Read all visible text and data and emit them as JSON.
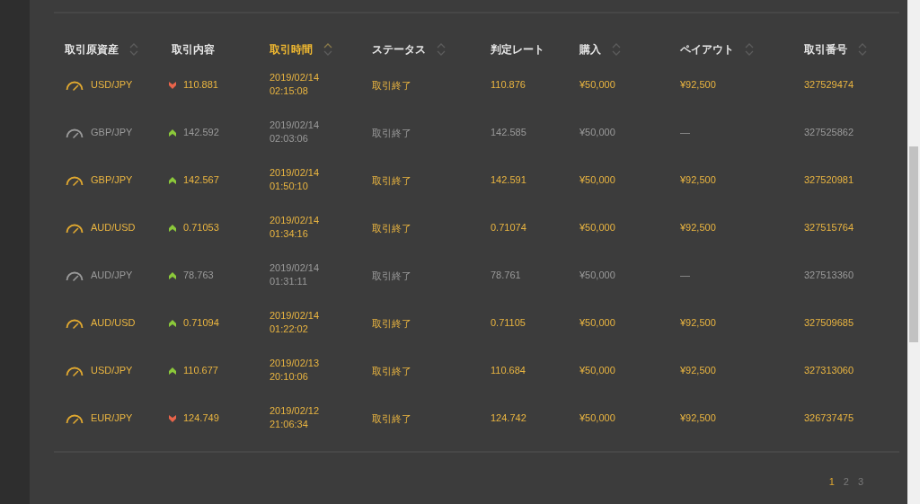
{
  "table": {
    "columns": [
      {
        "label": "取引原資産",
        "sortable": true,
        "active": false
      },
      {
        "label": "取引内容",
        "sortable": false,
        "active": false
      },
      {
        "label": "取引時間",
        "sortable": true,
        "active": true
      },
      {
        "label": "ステータス",
        "sortable": true,
        "active": false
      },
      {
        "label": "判定レート",
        "sortable": false,
        "active": false
      },
      {
        "label": "購入",
        "sortable": true,
        "active": false
      },
      {
        "label": "ペイアウト",
        "sortable": true,
        "active": false
      },
      {
        "label": "取引番号",
        "sortable": true,
        "active": false
      }
    ],
    "rows": [
      {
        "won": true,
        "asset": "USD/JPY",
        "rising": false,
        "entry": "110.881",
        "date": "2019/02/14",
        "time": "02:15:08",
        "status": "取引終了",
        "rate": "110.876",
        "purchase": "¥50,000",
        "payout": "¥92,500",
        "number": "327529474"
      },
      {
        "won": false,
        "asset": "GBP/JPY",
        "rising": true,
        "entry": "142.592",
        "date": "2019/02/14",
        "time": "02:03:06",
        "status": "取引終了",
        "rate": "142.585",
        "purchase": "¥50,000",
        "payout": "—",
        "number": "327525862"
      },
      {
        "won": true,
        "asset": "GBP/JPY",
        "rising": true,
        "entry": "142.567",
        "date": "2019/02/14",
        "time": "01:50:10",
        "status": "取引終了",
        "rate": "142.591",
        "purchase": "¥50,000",
        "payout": "¥92,500",
        "number": "327520981"
      },
      {
        "won": true,
        "asset": "AUD/USD",
        "rising": true,
        "entry": "0.71053",
        "date": "2019/02/14",
        "time": "01:34:16",
        "status": "取引終了",
        "rate": "0.71074",
        "purchase": "¥50,000",
        "payout": "¥92,500",
        "number": "327515764"
      },
      {
        "won": false,
        "asset": "AUD/JPY",
        "rising": true,
        "entry": "78.763",
        "date": "2019/02/14",
        "time": "01:31:11",
        "status": "取引終了",
        "rate": "78.761",
        "purchase": "¥50,000",
        "payout": "—",
        "number": "327513360"
      },
      {
        "won": true,
        "asset": "AUD/USD",
        "rising": true,
        "entry": "0.71094",
        "date": "2019/02/14",
        "time": "01:22:02",
        "status": "取引終了",
        "rate": "0.71105",
        "purchase": "¥50,000",
        "payout": "¥92,500",
        "number": "327509685"
      },
      {
        "won": true,
        "asset": "USD/JPY",
        "rising": true,
        "entry": "110.677",
        "date": "2019/02/13",
        "time": "20:10:06",
        "status": "取引終了",
        "rate": "110.684",
        "purchase": "¥50,000",
        "payout": "¥92,500",
        "number": "327313060"
      },
      {
        "won": true,
        "asset": "EUR/JPY",
        "rising": false,
        "entry": "124.749",
        "date": "2019/02/12",
        "time": "21:06:34",
        "status": "取引終了",
        "rate": "124.742",
        "purchase": "¥50,000",
        "payout": "¥92,500",
        "number": "326737475"
      }
    ]
  },
  "pagination": [
    {
      "label": "1",
      "selected": true
    },
    {
      "label": "2",
      "selected": false
    },
    {
      "label": "3",
      "selected": false
    }
  ]
}
